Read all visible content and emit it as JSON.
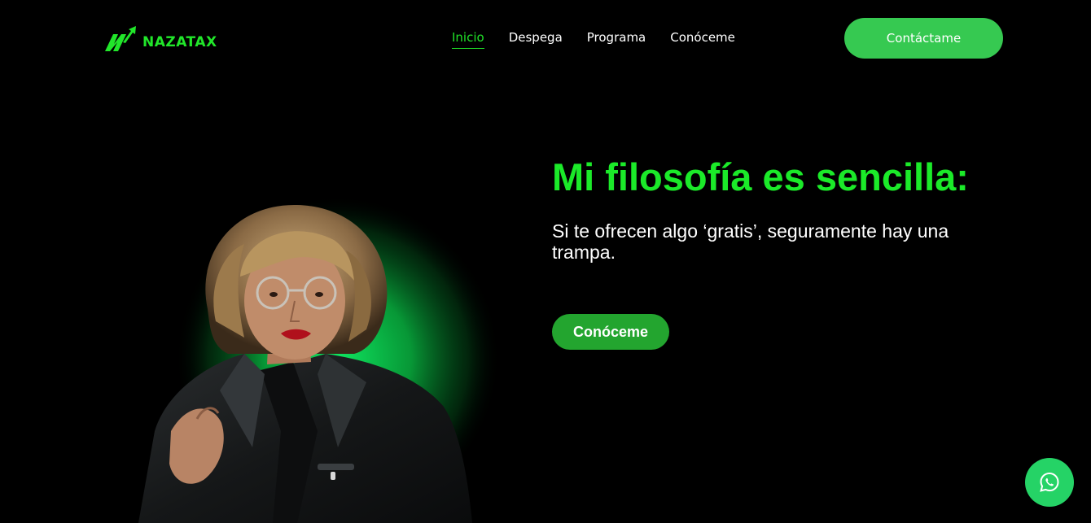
{
  "brand": {
    "name": "NAZATAX",
    "color": "#21e62a"
  },
  "nav": {
    "items": [
      {
        "label": "Inicio",
        "active": true
      },
      {
        "label": "Despega",
        "active": false
      },
      {
        "label": "Programa",
        "active": false
      },
      {
        "label": "Conóceme",
        "active": false
      }
    ]
  },
  "header": {
    "cta_label": "Contáctame",
    "cta_color": "#36c951"
  },
  "hero": {
    "title": "Mi filosofía es sencilla:",
    "subtitle": "Si te ofrecen algo ‘gratis’, seguramente hay una trampa.",
    "button_label": "Conóceme",
    "title_color": "#1bea29",
    "button_color": "#23a52f"
  },
  "floating": {
    "icon": "whatsapp-icon",
    "color": "#25d366"
  },
  "background_color": "#000000"
}
